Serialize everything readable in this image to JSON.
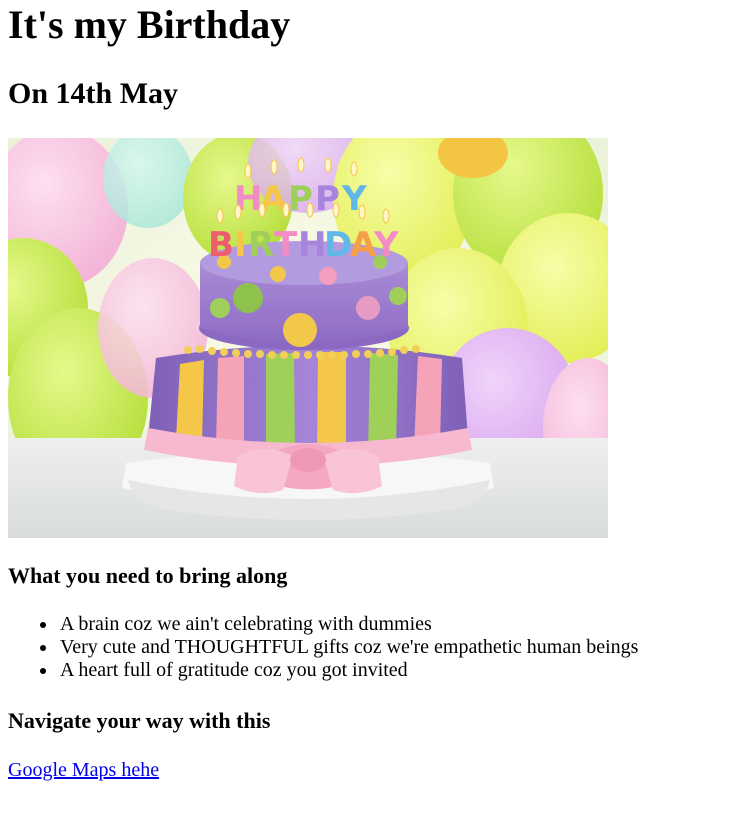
{
  "page": {
    "title": "It's my Birthday",
    "subtitle": "On 14th May",
    "hero_image": {
      "alt": "Happy Birthday cake",
      "candle_text": [
        "HAPPY",
        "BIRTHDAY"
      ]
    },
    "bring_heading": "What you need to bring along",
    "bring_items": [
      "A brain coz we ain't celebrating with dummies",
      "Very cute and THOUGHTFUL gifts coz we're empathetic human beings",
      "A heart full of gratitude coz you got invited"
    ],
    "nav_heading": "Navigate your way with this",
    "map_link": {
      "label": "Google Maps hehe"
    }
  },
  "colors": {
    "link": "#0000ee",
    "text": "#000000",
    "background": "#ffffff"
  }
}
